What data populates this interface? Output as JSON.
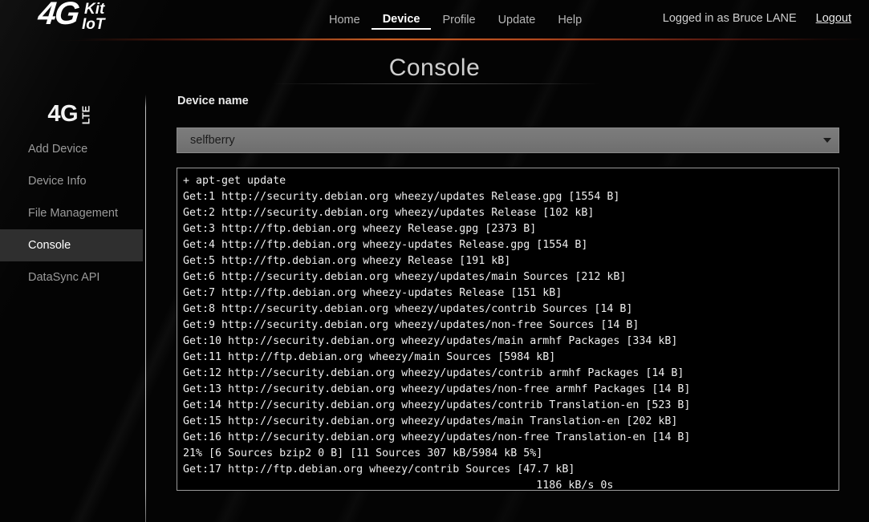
{
  "header": {
    "logo": {
      "part1": "4G",
      "part2": "Kit",
      "part3": "IoT"
    },
    "nav": [
      {
        "label": "Home",
        "active": false
      },
      {
        "label": "Device",
        "active": true
      },
      {
        "label": "Profile",
        "active": false
      },
      {
        "label": "Update",
        "active": false
      },
      {
        "label": "Help",
        "active": false
      }
    ],
    "user_status": "Logged in as Bruce LANE",
    "logout_label": "Logout"
  },
  "page": {
    "title": "Console"
  },
  "sidebar": {
    "logo_main": "4G",
    "logo_sup": "LTE",
    "items": [
      {
        "label": "Add Device",
        "active": false
      },
      {
        "label": "Device Info",
        "active": false
      },
      {
        "label": "File Management",
        "active": false
      },
      {
        "label": "Console",
        "active": true
      },
      {
        "label": "DataSync API",
        "active": false
      }
    ]
  },
  "main": {
    "device_name_label": "Device name",
    "device_select": {
      "value": "selfberry",
      "options": [
        "selfberry"
      ]
    },
    "console_output": "+ apt-get update\nGet:1 http://security.debian.org wheezy/updates Release.gpg [1554 B]\nGet:2 http://security.debian.org wheezy/updates Release [102 kB]\nGet:3 http://ftp.debian.org wheezy Release.gpg [2373 B]\nGet:4 http://ftp.debian.org wheezy-updates Release.gpg [1554 B]\nGet:5 http://ftp.debian.org wheezy Release [191 kB]\nGet:6 http://security.debian.org wheezy/updates/main Sources [212 kB]\nGet:7 http://ftp.debian.org wheezy-updates Release [151 kB]\nGet:8 http://security.debian.org wheezy/updates/contrib Sources [14 B]\nGet:9 http://security.debian.org wheezy/updates/non-free Sources [14 B]\nGet:10 http://security.debian.org wheezy/updates/main armhf Packages [334 kB]\nGet:11 http://ftp.debian.org wheezy/main Sources [5984 kB]\nGet:12 http://security.debian.org wheezy/updates/contrib armhf Packages [14 B]\nGet:13 http://security.debian.org wheezy/updates/non-free armhf Packages [14 B]\nGet:14 http://security.debian.org wheezy/updates/contrib Translation-en [523 B]\nGet:15 http://security.debian.org wheezy/updates/main Translation-en [202 kB]\nGet:16 http://security.debian.org wheezy/updates/non-free Translation-en [14 B]\n21% [6 Sources bzip2 0 B] [11 Sources 307 kB/5984 kB 5%]\nGet:17 http://ftp.debian.org wheezy/contrib Sources [47.7 kB]\n                                                       1186 kB/s 0s"
  },
  "colors": {
    "background": "#040404",
    "accent_rule": "#d66828",
    "sidebar_active_bg": "#2f2f2f",
    "select_bg": "#767676",
    "console_border": "#9a9a9a",
    "console_text": "#eeeeee"
  }
}
